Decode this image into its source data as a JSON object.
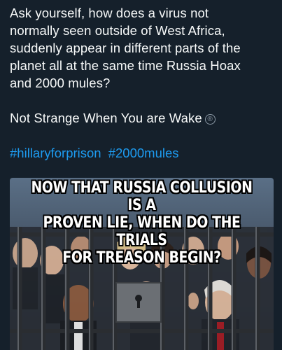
{
  "post": {
    "paragraph_1": "Ask yourself, how does a virus not\nnormally seen outside of West Africa,\nsuddenly appear in different parts of the\nplanet all at the same time Russia Hoax\nand 2000 mules?",
    "paragraph_2": "Not Strange When You are Wake",
    "registered_mark": "®",
    "hashtags": [
      "#hillaryforprison",
      "#2000mules"
    ]
  },
  "media": {
    "headline": "NOW THAT RUSSIA COLLUSION IS A\nPROVEN LIE, WHEN DO THE TRIALS\nFOR TREASON BEGIN?",
    "colors": {
      "sky": "#5a6f86",
      "bars": "#2a2d31",
      "bar_highlight": "#8a8f96",
      "text": "#ffffff",
      "text_outline": "#000000"
    }
  },
  "theme": {
    "background": "#15202b",
    "text": "#f7f9f9",
    "link": "#1d9bf0"
  }
}
